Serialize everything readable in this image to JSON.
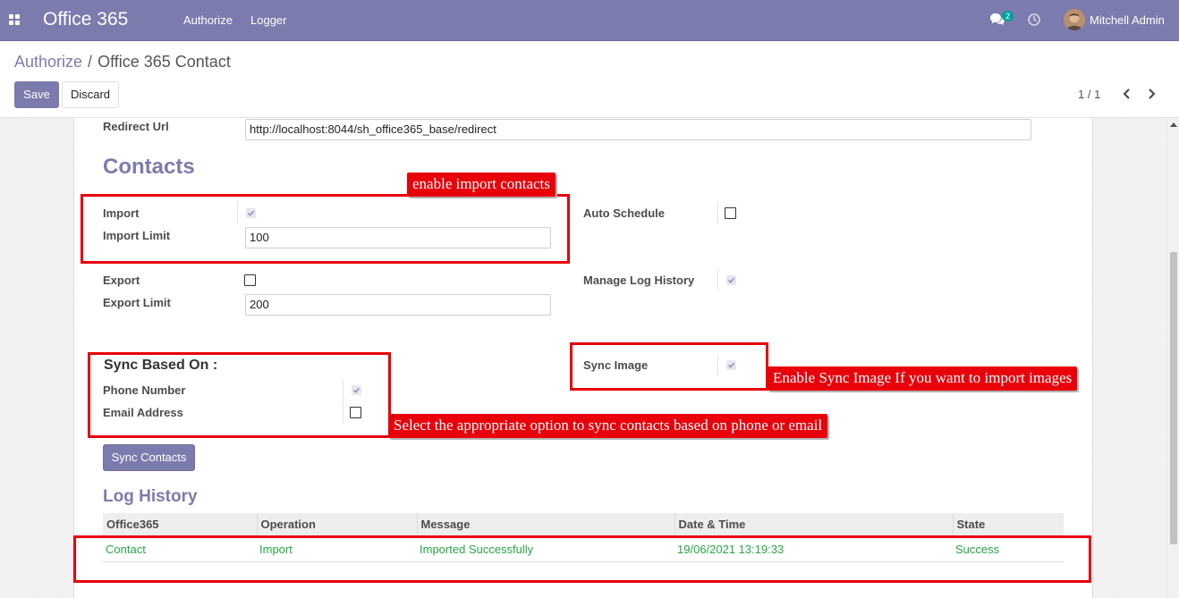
{
  "navbar": {
    "brand": "Office 365",
    "menu": [
      "Authorize",
      "Logger"
    ],
    "chat_count": "2",
    "user_name": "Mitchell Admin"
  },
  "breadcrumb": {
    "parent": "Authorize",
    "separator": "/",
    "current": "Office 365 Contact"
  },
  "buttons": {
    "save": "Save",
    "discard": "Discard",
    "sync_contacts": "Sync Contacts"
  },
  "pager": {
    "value": "1 / 1"
  },
  "form": {
    "redirect_url_label": "Redirect Url",
    "redirect_url_value": "http://localhost:8044/sh_office365_base/redirect",
    "contacts_title": "Contacts",
    "import_label": "Import",
    "import_checked": true,
    "import_limit_label": "Import Limit",
    "import_limit_value": "100",
    "export_label": "Export",
    "export_checked": false,
    "export_limit_label": "Export Limit",
    "export_limit_value": "200",
    "auto_schedule_label": "Auto Schedule",
    "auto_schedule_checked": false,
    "manage_log_label": "Manage Log History",
    "manage_log_checked": true,
    "sync_based_on_title": "Sync Based On :",
    "phone_label": "Phone Number",
    "phone_checked": true,
    "email_label": "Email Address",
    "email_checked": false,
    "sync_image_label": "Sync Image",
    "sync_image_checked": true
  },
  "log": {
    "title": "Log History",
    "columns": [
      "Office365",
      "Operation",
      "Message",
      "Date & Time",
      "State"
    ],
    "rows": [
      [
        "Contact",
        "Import",
        "Imported Successfully",
        "19/06/2021 13:19:33",
        "Success"
      ]
    ]
  },
  "annotations": {
    "import": "enable import contacts",
    "sync_image": "Enable Sync Image If you want to import images",
    "sync_based": "Select the appropriate option to sync contacts based on phone or email"
  },
  "colors": {
    "primary": "#7c7bad",
    "success_text": "#28a745",
    "annotation_red": "#e8000b"
  }
}
